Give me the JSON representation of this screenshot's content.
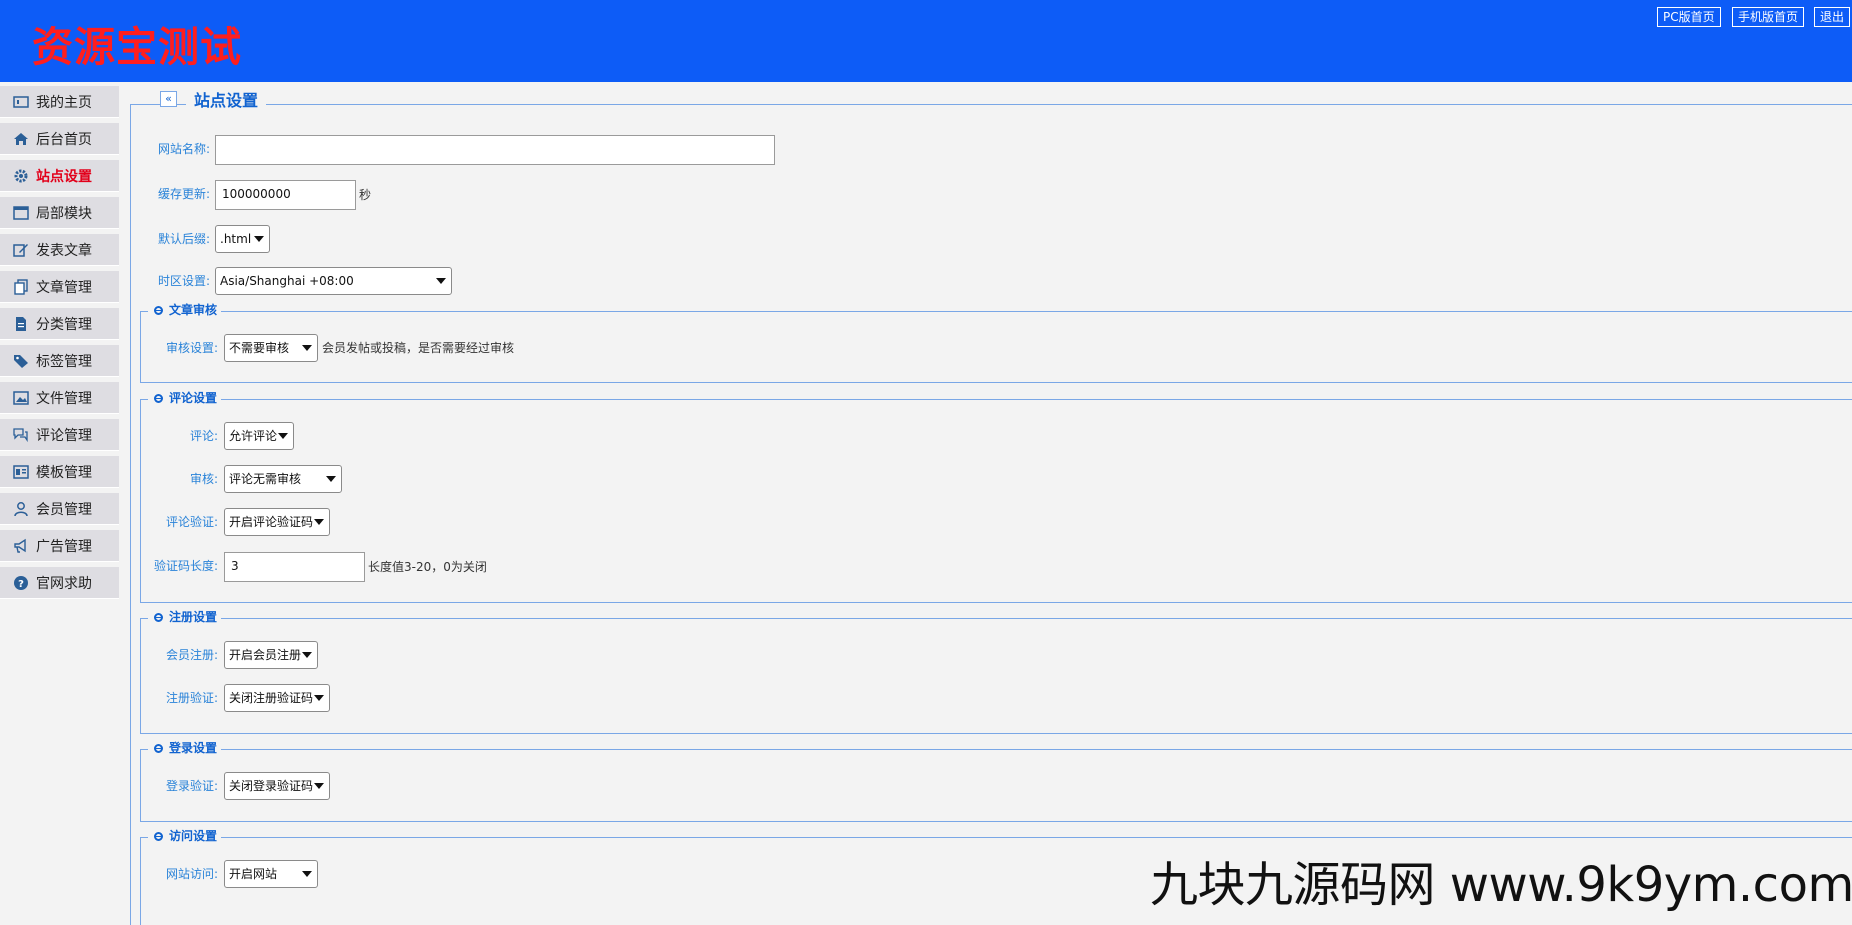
{
  "header": {
    "site_title": "资源宝测试",
    "links": {
      "pc_home": "PC版首页",
      "mobile_home": "手机版首页",
      "logout": "退出"
    }
  },
  "sidebar": {
    "items": [
      {
        "label": "我的主页",
        "icon": "id-card-icon"
      },
      {
        "label": "后台首页",
        "icon": "home-icon"
      },
      {
        "label": "站点设置",
        "icon": "gear-icon",
        "active": true
      },
      {
        "label": "局部模块",
        "icon": "window-icon"
      },
      {
        "label": "发表文章",
        "icon": "edit-icon"
      },
      {
        "label": "文章管理",
        "icon": "documents-icon"
      },
      {
        "label": "分类管理",
        "icon": "file-icon"
      },
      {
        "label": "标签管理",
        "icon": "tag-icon"
      },
      {
        "label": "文件管理",
        "icon": "image-icon"
      },
      {
        "label": "评论管理",
        "icon": "comments-icon"
      },
      {
        "label": "模板管理",
        "icon": "template-icon"
      },
      {
        "label": "会员管理",
        "icon": "user-icon"
      },
      {
        "label": "广告管理",
        "icon": "megaphone-icon"
      },
      {
        "label": "官网求助",
        "icon": "help-icon"
      }
    ]
  },
  "panel": {
    "title": "站点设置",
    "collapse_symbol": "«"
  },
  "basic": {
    "site_name_label": "网站名称:",
    "site_name_value": "",
    "cache_label": "缓存更新:",
    "cache_value": "100000000",
    "cache_unit": "秒",
    "suffix_label": "默认后缀:",
    "suffix_value": ".html",
    "timezone_label": "时区设置:",
    "timezone_value": "Asia/Shanghai +08:00"
  },
  "article_review": {
    "legend": "文章审核",
    "review_label": "审核设置:",
    "review_value": "不需要审核",
    "review_hint": "会员发帖或投稿，是否需要经过审核"
  },
  "comment_settings": {
    "legend": "评论设置",
    "comment_label": "评论:",
    "comment_value": "允许评论",
    "audit_label": "审核:",
    "audit_value": "评论无需审核",
    "captcha_label": "评论验证:",
    "captcha_value": "开启评论验证码",
    "captcha_len_label": "验证码长度:",
    "captcha_len_value": "3",
    "captcha_len_hint": "长度值3-20，0为关闭"
  },
  "register_settings": {
    "legend": "注册设置",
    "register_label": "会员注册:",
    "register_value": "开启会员注册",
    "register_captcha_label": "注册验证:",
    "register_captcha_value": "关闭注册验证码"
  },
  "login_settings": {
    "legend": "登录设置",
    "login_captcha_label": "登录验证:",
    "login_captcha_value": "关闭登录验证码"
  },
  "access_settings": {
    "legend": "访问设置",
    "access_label": "网站访问:",
    "access_value": "开启网站"
  },
  "watermark": "九块九源码网 www.9k9ym.com",
  "colors": {
    "header_bg": "#0d5cf7",
    "title_red": "#ff1e1e",
    "accent_blue": "#1163d0",
    "label_blue": "#2a83d8",
    "active_red": "#e2001a",
    "sidebar_bg": "#dedde2"
  }
}
